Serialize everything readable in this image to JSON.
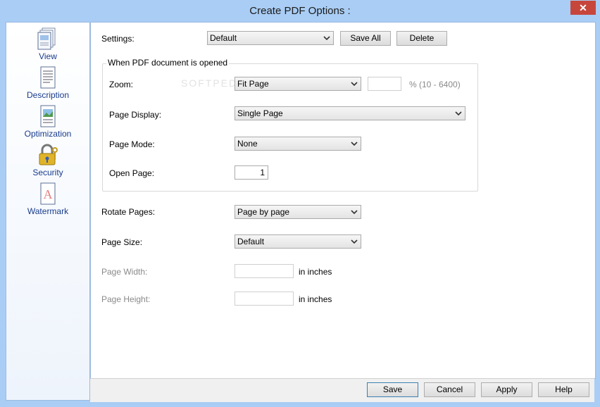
{
  "window": {
    "title": "Create PDF Options :",
    "close_glyph": "✕"
  },
  "sidebar": {
    "items": [
      {
        "label": "View",
        "icon": "view-page-icon"
      },
      {
        "label": "Description",
        "icon": "description-document-icon"
      },
      {
        "label": "Optimization",
        "icon": "optimization-image-icon"
      },
      {
        "label": "Security",
        "icon": "security-padlock-icon"
      },
      {
        "label": "Watermark",
        "icon": "watermark-icon"
      }
    ]
  },
  "settings": {
    "label": "Settings:",
    "value": "Default",
    "save_all_label": "Save All",
    "delete_label": "Delete"
  },
  "when_opened": {
    "group_title": "When PDF document is opened",
    "zoom": {
      "label": "Zoom:",
      "value": "Fit Page",
      "percent_value": "",
      "range_text": "%  (10  -  6400)"
    },
    "page_display": {
      "label": "Page Display:",
      "value": "Single Page"
    },
    "page_mode": {
      "label": "Page Mode:",
      "value": "None"
    },
    "open_page": {
      "label": "Open Page:",
      "value": "1"
    }
  },
  "rotate_pages": {
    "label": "Rotate Pages:",
    "value": "Page by page"
  },
  "page_size": {
    "label": "Page Size:",
    "value": "Default"
  },
  "page_width": {
    "label": "Page Width:",
    "value": "",
    "unit": "in inches"
  },
  "page_height": {
    "label": "Page Height:",
    "value": "",
    "unit": "in inches"
  },
  "footer": {
    "save_label": "Save",
    "cancel_label": "Cancel",
    "apply_label": "Apply",
    "help_label": "Help"
  },
  "watermark_text": "SOFTPEDIA",
  "colors": {
    "window_bg": "#a9cdf4",
    "sidebar_text": "#1a3c8c",
    "close_button": "#c7463c"
  }
}
